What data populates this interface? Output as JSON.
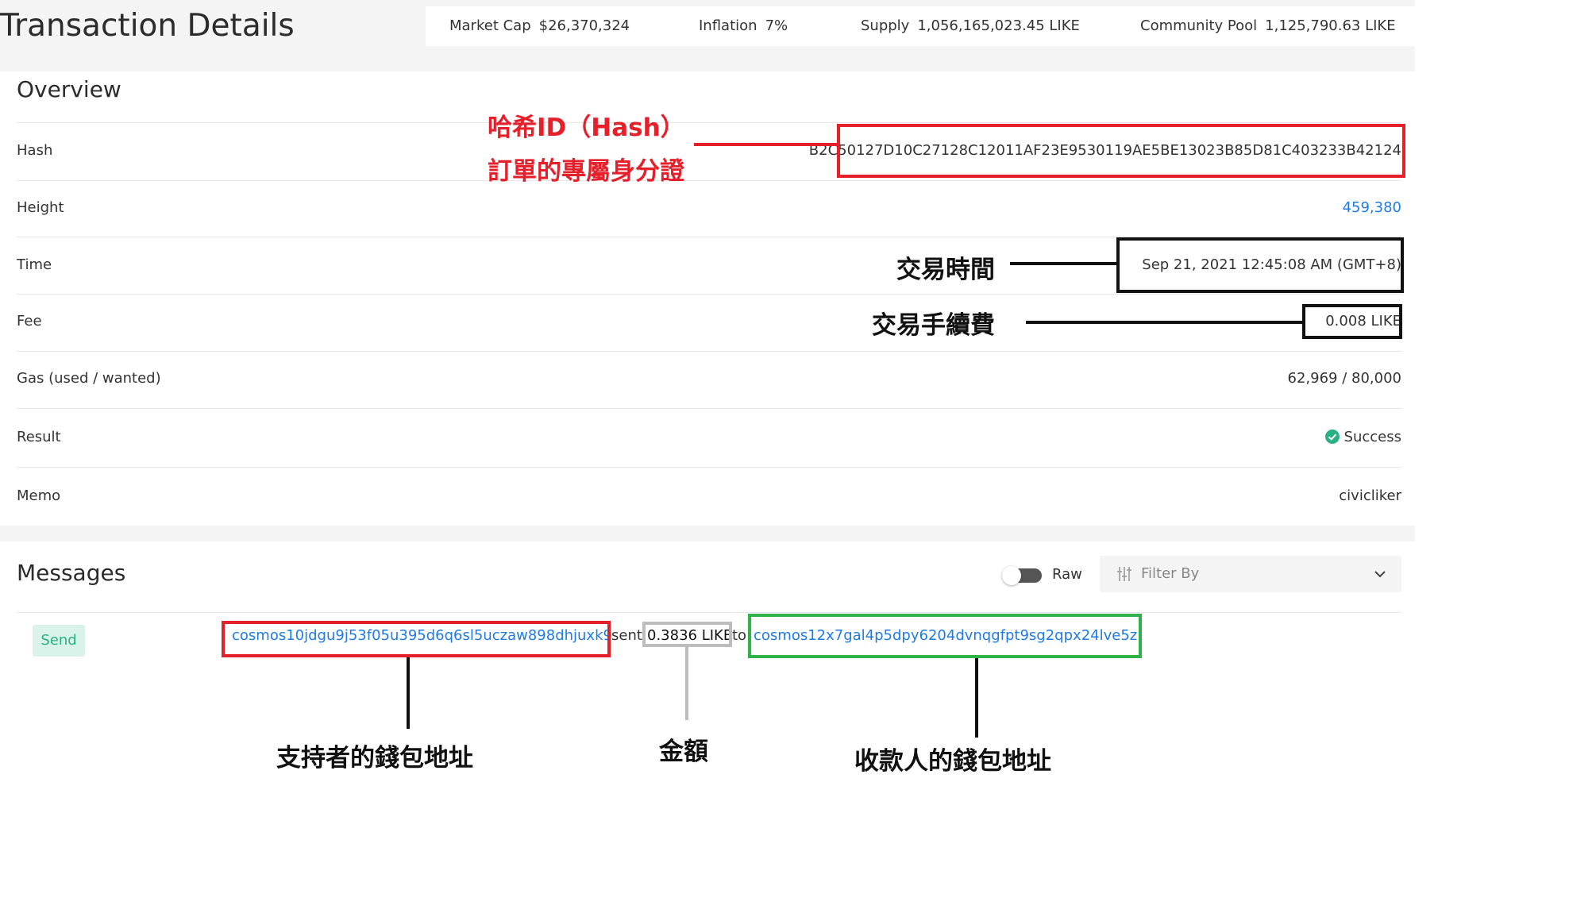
{
  "page": {
    "title": "Transaction Details"
  },
  "stats": [
    {
      "label": "Market Cap",
      "value": "$26,370,324"
    },
    {
      "label": "Inflation",
      "value": "7%"
    },
    {
      "label": "Supply",
      "value": "1,056,165,023.45 LIKE"
    },
    {
      "label": "Community Pool",
      "value": "1,125,790.63 LIKE"
    }
  ],
  "overview": {
    "title": "Overview",
    "rows": [
      {
        "label": "Hash",
        "value": "B2C50127D10C27128C12011AF23E9530119AE5BE13023B85D81C403233B42124"
      },
      {
        "label": "Height",
        "value": "459,380"
      },
      {
        "label": "Time",
        "value": "Sep 21, 2021 12:45:08 AM (GMT+8)"
      },
      {
        "label": "Fee",
        "value": "0.008 LIKE"
      },
      {
        "label": "Gas (used / wanted)",
        "value": "62,969 / 80,000"
      },
      {
        "label": "Result",
        "value": "Success"
      },
      {
        "label": "Memo",
        "value": "civicliker"
      }
    ]
  },
  "messages": {
    "title": "Messages",
    "raw_label": "Raw",
    "filter_placeholder": "Filter By",
    "type_badge": "Send",
    "from_address": "cosmos10jdgu9j53f05u395d6q6sl5uczaw898dhjuxk9",
    "sent_word": "sent",
    "amount": "0.3836 LIKE",
    "to_word": "to",
    "to_address": "cosmos12x7gal4p5dpy6204dvnqgfpt9sg2qpx24lve5z"
  },
  "annotations": {
    "hash_line1": "哈希ID（Hash）",
    "hash_line2": "訂單的專屬身分證",
    "time": "交易時間",
    "fee": "交易手續費",
    "sender": "支持者的錢包地址",
    "amount": "金額",
    "receiver": "收款人的錢包地址"
  },
  "colors": {
    "link": "#1f7be6",
    "success": "#2bb085",
    "annotation_red": "#e5202b",
    "annotation_green": "#2eb34a",
    "annotation_gray": "#bdbdbd"
  }
}
